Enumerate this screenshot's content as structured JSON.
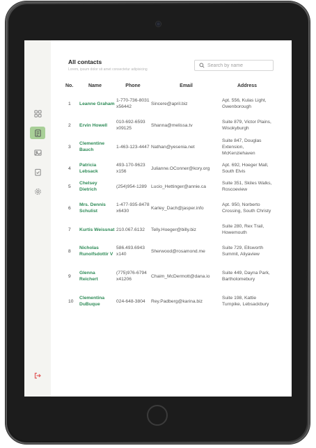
{
  "header": {
    "title": "All contacts",
    "subtitle": "Lorem, ipsum dolor sit amet consectetur adipisicing",
    "search_placeholder": "Search by name"
  },
  "sidebar": {
    "items": [
      {
        "icon": "grid-icon",
        "active": false
      },
      {
        "icon": "contacts-icon",
        "active": true
      },
      {
        "icon": "image-icon",
        "active": false
      },
      {
        "icon": "checklist-icon",
        "active": false
      },
      {
        "icon": "settings-gear-icon",
        "active": false
      }
    ],
    "logout_icon": "logout-icon",
    "active_color": "#a8cf97",
    "accent_color": "#2e8b57",
    "logout_color": "#e05a5a"
  },
  "table": {
    "headers": [
      "No.",
      "Name",
      "Phone",
      "Email",
      "Address"
    ],
    "rows": [
      {
        "no": "1",
        "name": "Leanne Graham",
        "phone": "1-770-736-8031 x56442",
        "email": "Sincere@april.biz",
        "address": "Apt. 556, Kulas Light, Gwenborough"
      },
      {
        "no": "2",
        "name": "Ervin Howell",
        "phone": "010-692-6593 x09125",
        "email": "Shanna@melissa.tv",
        "address": "Suite 879, Victor Plains, Wisokyburgh"
      },
      {
        "no": "3",
        "name": "Clementine Bauch",
        "phone": "1-463-123-4447",
        "email": "Nathan@yesenia.net",
        "address": "Suite 847, Douglas Extension, McKenziehaven"
      },
      {
        "no": "4",
        "name": "Patricia Lebsack",
        "phone": "493-170-9623 x156",
        "email": "Julianne.OConner@kory.org",
        "address": "Apt. 692, Hoeger Mall, South Elvis"
      },
      {
        "no": "5",
        "name": "Chelsey Dietrich",
        "phone": "(254)954-1289",
        "email": "Lucio_Hettinger@annie.ca",
        "address": "Suite 351, Skiles Walks, Roscoeview"
      },
      {
        "no": "6",
        "name": "Mrs. Dennis Schulist",
        "phone": "1-477-935-8478 x6430",
        "email": "Karley_Dach@jasper.info",
        "address": "Apt. 950, Norberto Crossing, South Christy"
      },
      {
        "no": "7",
        "name": "Kurtis Weissnat",
        "phone": "210.067.6132",
        "email": "Telly.Hoeger@billy.biz",
        "address": "Suite 280, Rex Trail, Howemouth"
      },
      {
        "no": "8",
        "name": "Nicholas Runolfsdottir V",
        "phone": "586.493.6943 x140",
        "email": "Sherwood@rosamond.me",
        "address": "Suite 729, Ellsworth Summit, Aliyaview"
      },
      {
        "no": "9",
        "name": "Glenna Reichert",
        "phone": "(775)976-6794 x41206",
        "email": "Chaim_McDermott@dana.io",
        "address": "Suite 449, Dayna Park, Bartholomebury"
      },
      {
        "no": "10",
        "name": "Clementina DuBuque",
        "phone": "024-648-3804",
        "email": "Rey.Padberg@karina.biz",
        "address": "Suite 198, Kattie Turnpike, Lebsackbury"
      }
    ]
  }
}
